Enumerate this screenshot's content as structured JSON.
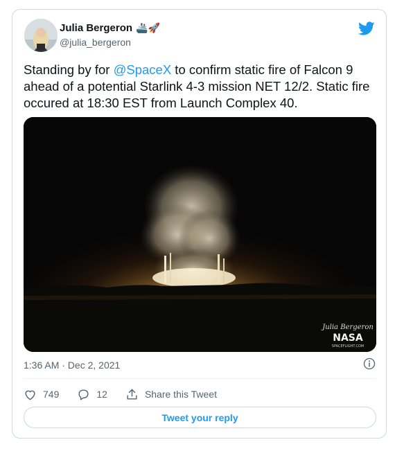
{
  "tweet": {
    "author_name": "Julia Bergeron",
    "author_emojis": "🚢🚀",
    "handle": "@julia_bergeron",
    "text_before": "Standing by for ",
    "mention": "@SpaceX",
    "text_after": " to confirm static fire of Falcon 9 ahead of a potential Starlink 4-3 mission NET 12/2. Static fire occured at 18:30 EST from Launch Complex 40.",
    "timestamp": "1:36 AM · Dec 2, 2021",
    "likes": "749",
    "replies": "12",
    "share_label": "Share this Tweet",
    "reply_button_label": "Tweet your reply",
    "watermark_signature": "Julia Bergeron",
    "watermark_logo": "NASA",
    "watermark_site": "SPACEFLIGHT.COM"
  },
  "icons": {
    "brand": "twitter-bird-icon",
    "like": "heart-icon",
    "reply": "reply-bubble-icon",
    "share": "share-icon",
    "info": "info-icon"
  },
  "colors": {
    "accent": "#1d9bf0",
    "text": "#0f1419",
    "muted": "#536471",
    "border": "#cfd9de"
  }
}
